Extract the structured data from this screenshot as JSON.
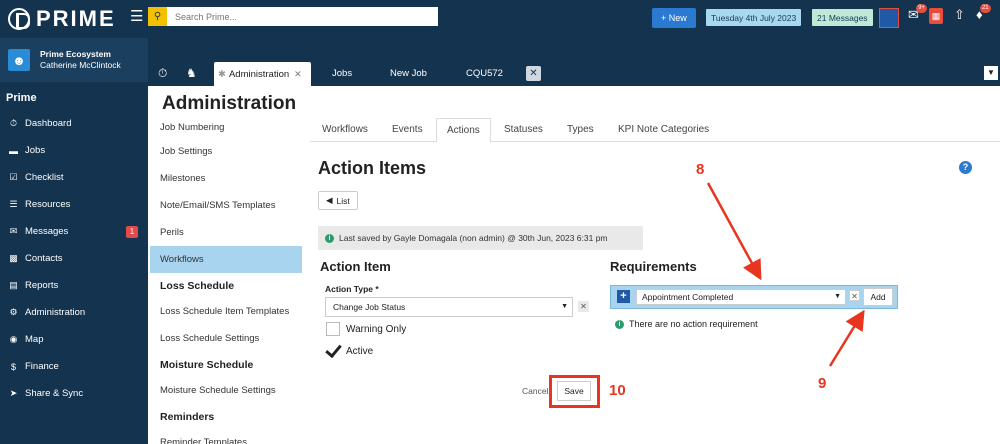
{
  "app": {
    "logo_text": "PRIME"
  },
  "user": {
    "org": "Prime Ecosystem",
    "name": "Catherine McClintock"
  },
  "sidebar": {
    "section": "Prime",
    "items": [
      {
        "label": "Dashboard",
        "icon": "dashboard-icon"
      },
      {
        "label": "Jobs",
        "icon": "folder-icon"
      },
      {
        "label": "Checklist",
        "icon": "checklist-icon"
      },
      {
        "label": "Resources",
        "icon": "resources-icon"
      },
      {
        "label": "Messages",
        "icon": "envelope-icon",
        "badge": "1"
      },
      {
        "label": "Contacts",
        "icon": "contacts-icon"
      },
      {
        "label": "Reports",
        "icon": "reports-icon"
      },
      {
        "label": "Administration",
        "icon": "gear-icon"
      },
      {
        "label": "Map",
        "icon": "map-icon"
      },
      {
        "label": "Finance",
        "icon": "dollar-icon"
      },
      {
        "label": "Share & Sync",
        "icon": "share-icon"
      }
    ]
  },
  "topbar": {
    "search_placeholder": "Search Prime...",
    "new_label": "+ New",
    "date": "Tuesday 4th July 2023",
    "messages": "21 Messages",
    "chat_badge": "9+",
    "bell_badge": "21",
    "accent": "#14334e"
  },
  "tabs": {
    "active": "Administration",
    "items": [
      "Jobs",
      "New Job",
      "CQU572"
    ]
  },
  "page": {
    "title": "Administration",
    "subnav": {
      "first": "Job Numbering",
      "items": [
        "Job Settings",
        "Milestones",
        "Note/Email/SMS Templates",
        "Perils",
        "Workflows"
      ],
      "sections": [
        {
          "head": "Loss Schedule",
          "items": [
            "Loss Schedule Item Templates",
            "Loss Schedule Settings"
          ]
        },
        {
          "head": "Moisture Schedule",
          "items": [
            "Moisture Schedule Settings"
          ]
        },
        {
          "head": "Reminders",
          "items": [
            "Reminder Templates"
          ]
        }
      ]
    },
    "inner_tabs": [
      "Workflows",
      "Events",
      "Actions",
      "Statuses",
      "Types",
      "KPI Note Categories"
    ]
  },
  "action_items": {
    "title": "Action Items",
    "list_label": "List",
    "saved_text": "Last saved by Gayle Domagala (non admin) @ 30th Jun, 2023 6:31 pm",
    "action_item_heading": "Action Item",
    "action_type_label": "Action Type *",
    "action_type_value": "Change Job Status",
    "warning_only_label": "Warning Only",
    "active_label": "Active",
    "warning_only_checked": false,
    "active_checked": true,
    "requirements_heading": "Requirements",
    "requirement_value": "Appointment Completed",
    "add_label": "Add",
    "no_requirements": "There are no action requirement",
    "cancel_label": "Cancel",
    "save_label": "Save"
  },
  "annotations": {
    "n8": "8",
    "n9": "9",
    "n10": "10",
    "color": "#e8351f"
  }
}
